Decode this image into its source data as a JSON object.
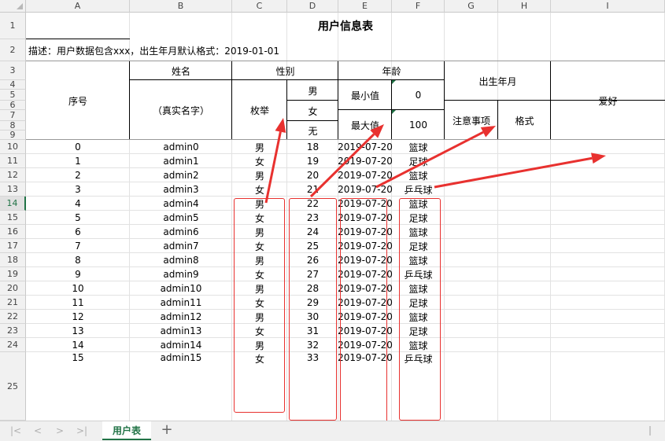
{
  "columns": [
    "A",
    "B",
    "C",
    "D",
    "E",
    "F",
    "G",
    "H",
    "I"
  ],
  "rows": [
    "1",
    "2",
    "3",
    "4",
    "5",
    "6",
    "7",
    "8",
    "9",
    "10",
    "11",
    "12",
    "13",
    "14",
    "15",
    "16",
    "17",
    "18",
    "19",
    "20",
    "21",
    "22",
    "23",
    "24",
    "25"
  ],
  "selected_row": "14",
  "header": {
    "title": "用户信息表",
    "description": "描述：用户数据包含xxx，出生年月默认格式：2019-01-01",
    "xuhao": "序号",
    "name": "姓名",
    "name_note": "（真实名字）",
    "gender": "性别",
    "enum": "枚举",
    "male": "男",
    "female": "女",
    "none": "无",
    "age": "年龄",
    "min_label": "最小值",
    "min_value": "0",
    "max_label": "最大值",
    "max_value": "100",
    "birth": "出生年月",
    "notes": "注意事项",
    "format": "格式",
    "hobby": "爱好"
  },
  "data_rows": [
    {
      "id": "0",
      "name": "admin0",
      "gender": "男",
      "age": "18",
      "birth": "2019-07-20",
      "hobby": "篮球"
    },
    {
      "id": "1",
      "name": "admin1",
      "gender": "女",
      "age": "19",
      "birth": "2019-07-20",
      "hobby": "足球"
    },
    {
      "id": "2",
      "name": "admin2",
      "gender": "男",
      "age": "20",
      "birth": "2019-07-20",
      "hobby": "篮球"
    },
    {
      "id": "3",
      "name": "admin3",
      "gender": "女",
      "age": "21",
      "birth": "2019-07-20",
      "hobby": "乒乓球"
    },
    {
      "id": "4",
      "name": "admin4",
      "gender": "男",
      "age": "22",
      "birth": "2019-07-20",
      "hobby": "篮球"
    },
    {
      "id": "5",
      "name": "admin5",
      "gender": "女",
      "age": "23",
      "birth": "2019-07-20",
      "hobby": "足球"
    },
    {
      "id": "6",
      "name": "admin6",
      "gender": "男",
      "age": "24",
      "birth": "2019-07-20",
      "hobby": "篮球"
    },
    {
      "id": "7",
      "name": "admin7",
      "gender": "女",
      "age": "25",
      "birth": "2019-07-20",
      "hobby": "足球"
    },
    {
      "id": "8",
      "name": "admin8",
      "gender": "男",
      "age": "26",
      "birth": "2019-07-20",
      "hobby": "篮球"
    },
    {
      "id": "9",
      "name": "admin9",
      "gender": "女",
      "age": "27",
      "birth": "2019-07-20",
      "hobby": "乒乓球"
    },
    {
      "id": "10",
      "name": "admin10",
      "gender": "男",
      "age": "28",
      "birth": "2019-07-20",
      "hobby": "篮球"
    },
    {
      "id": "11",
      "name": "admin11",
      "gender": "女",
      "age": "29",
      "birth": "2019-07-20",
      "hobby": "足球"
    },
    {
      "id": "12",
      "name": "admin12",
      "gender": "男",
      "age": "30",
      "birth": "2019-07-20",
      "hobby": "篮球"
    },
    {
      "id": "13",
      "name": "admin13",
      "gender": "女",
      "age": "31",
      "birth": "2019-07-20",
      "hobby": "足球"
    },
    {
      "id": "14",
      "name": "admin14",
      "gender": "男",
      "age": "32",
      "birth": "2019-07-20",
      "hobby": "篮球"
    },
    {
      "id": "15",
      "name": "admin15",
      "gender": "女",
      "age": "33",
      "birth": "2019-07-20",
      "hobby": "乒乓球"
    }
  ],
  "sheet_tabs": {
    "active": "用户表",
    "add_icon": "+",
    "nav_icons": [
      "|<",
      "<",
      ">",
      ">|"
    ]
  },
  "colors": {
    "accent": "#217346",
    "annotation": "#e8312f"
  }
}
